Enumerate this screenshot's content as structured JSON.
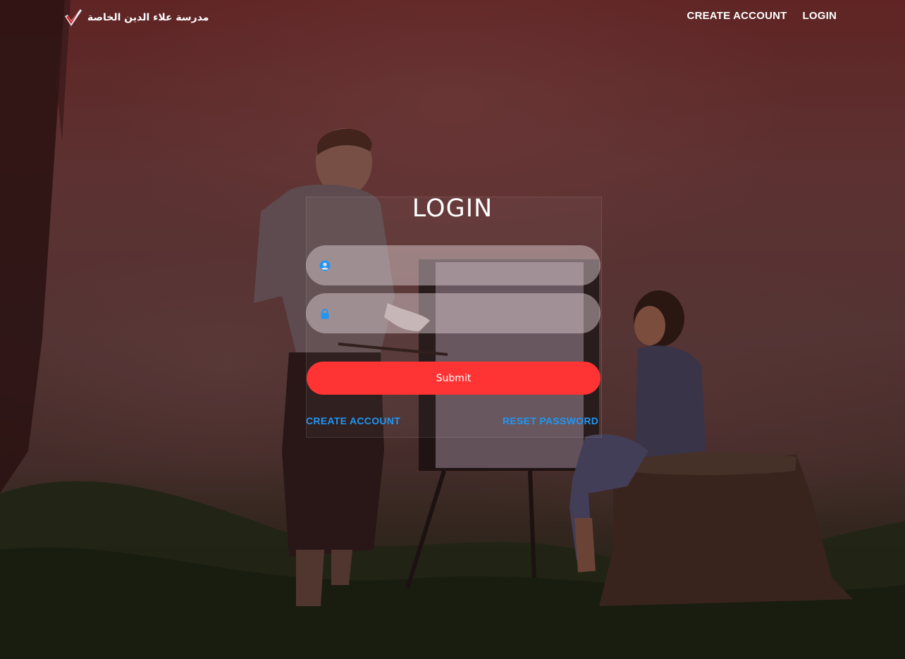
{
  "brand": {
    "name": "مدرسة علاء الدين الخاصة",
    "logo_icon": "checkmark-logo-icon"
  },
  "nav": {
    "create_account": "CREATE ACCOUNT",
    "login": "LOGIN"
  },
  "login_form": {
    "title": "LOGIN",
    "username": {
      "icon": "user-icon",
      "value": "",
      "placeholder": ""
    },
    "password": {
      "icon": "lock-icon",
      "value": "",
      "placeholder": ""
    },
    "submit_label": "Submit",
    "create_account_link": "CREATE ACCOUNT",
    "reset_password_link": "RESET PASSWORD"
  },
  "colors": {
    "accent": "#fe3434",
    "link": "#2196f3",
    "icon": "#2196f3",
    "overlay": "#6d2a2a"
  }
}
